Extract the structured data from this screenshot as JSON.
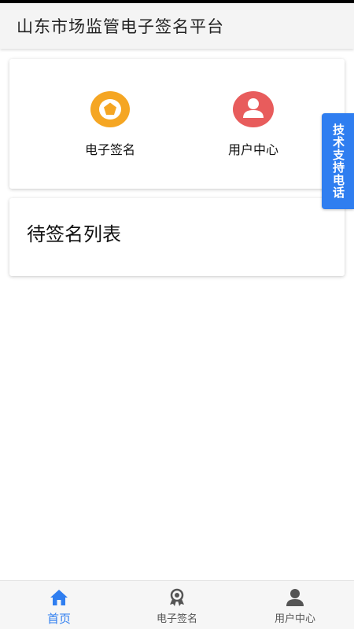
{
  "app_bar": {
    "title": "山东市场监管电子签名平台"
  },
  "menu": {
    "items": [
      {
        "label": "电子签名",
        "icon": "signature-badge-icon",
        "color": "#f5a623"
      },
      {
        "label": "用户中心",
        "icon": "user-icon",
        "color": "#e85c5c"
      }
    ]
  },
  "pending_list": {
    "title": "待签名列表"
  },
  "support_tab": {
    "label": "技术支持电话",
    "color": "#2f7ef0"
  },
  "bottom_nav": {
    "active_index": 0,
    "active_color": "#2f7ef0",
    "inactive_color": "#555555",
    "items": [
      {
        "label": "首页",
        "icon": "home-icon"
      },
      {
        "label": "电子签名",
        "icon": "award-ribbon-icon"
      },
      {
        "label": "用户中心",
        "icon": "person-icon"
      }
    ]
  }
}
